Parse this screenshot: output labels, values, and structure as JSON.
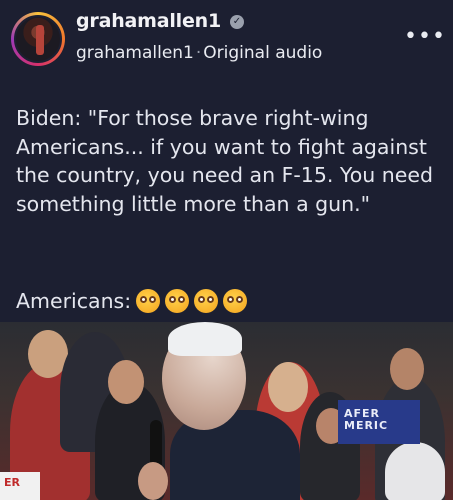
{
  "post": {
    "username": "grahamallen1",
    "subline_user": "grahamallen1",
    "subline_separator": "·",
    "audio_label": "Original audio",
    "more_icon": "more-horizontal-icon"
  },
  "caption": {
    "text": "Biden: \"For those brave right-wing Americans... if you want to fight against the country, you need an F-15. You need something little more than a gun.\"",
    "reaction_text": "Americans:",
    "reaction_emojis": [
      "flushed-face-emoji",
      "flushed-face-emoji",
      "flushed-face-emoji",
      "flushed-face-emoji"
    ]
  },
  "video": {
    "sign_text_1": "AFER",
    "sign_text_2": "MERIC",
    "sign_text_3": "ER"
  }
}
